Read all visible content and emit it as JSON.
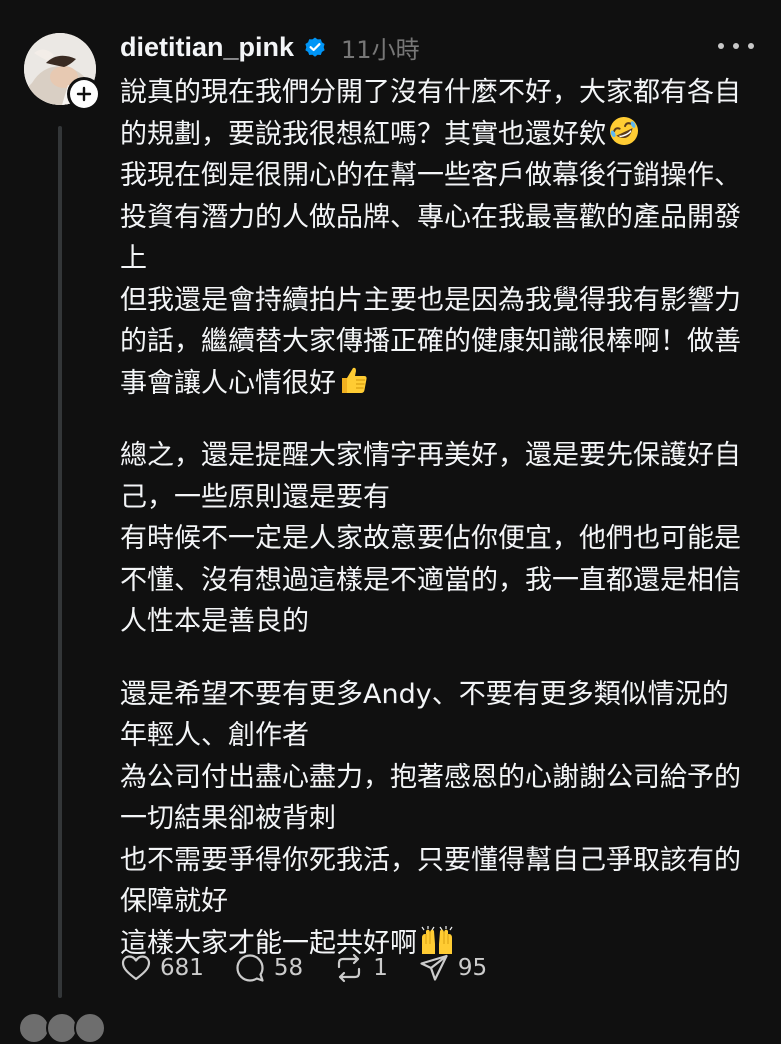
{
  "post": {
    "username": "dietitian_pink",
    "timestamp": "11小時",
    "verified_color": "#0095f6",
    "more_icon": "more-horizontal-icon",
    "paragraphs": [
      {
        "lines": [
          "說真的現在我們分開了沒有什麼不好，大家都有各自",
          "的規劃，要說我很想紅嗎？其實也還好欸"
        ],
        "emoji": "rolling-on-floor-laughing-emoji"
      },
      {
        "lines": [
          "我現在倒是很開心的在幫一些客戶做幕後行銷操作、",
          "投資有潛力的人做品牌、專心在我最喜歡的產品開發",
          "上"
        ]
      },
      {
        "lines": [
          "但我還是會持續拍片主要也是因為我覺得我有影響力",
          "的話，繼續替大家傳播正確的健康知識很棒啊！做善",
          "事會讓人心情很好"
        ],
        "emoji": "thumbs-up-emoji"
      },
      {
        "lines": [
          "總之，還是提醒大家情字再美好，還是要先保護好自",
          "己，一些原則還是要有"
        ]
      },
      {
        "lines": [
          "有時候不一定是人家故意要佔你便宜，他們也可能是",
          "不懂、沒有想過這樣是不適當的，我一直都還是相信",
          "人性本是善良的"
        ]
      },
      {
        "lines": [
          "還是希望不要有更多Andy、不要有更多類似情況的",
          "年輕人、創作者"
        ]
      },
      {
        "lines": [
          "為公司付出盡心盡力，抱著感恩的心謝謝公司給予的",
          "一切結果卻被背刺"
        ]
      },
      {
        "lines": [
          "也不需要爭得你死我活，只要懂得幫自己爭取該有的",
          "保障就好"
        ]
      },
      {
        "lines": [
          "這樣大家才能一起共好啊"
        ],
        "emoji": "raising-hands-emoji"
      }
    ],
    "actions": {
      "likes": "681",
      "comments": "58",
      "reposts": "1",
      "shares": "95"
    }
  }
}
